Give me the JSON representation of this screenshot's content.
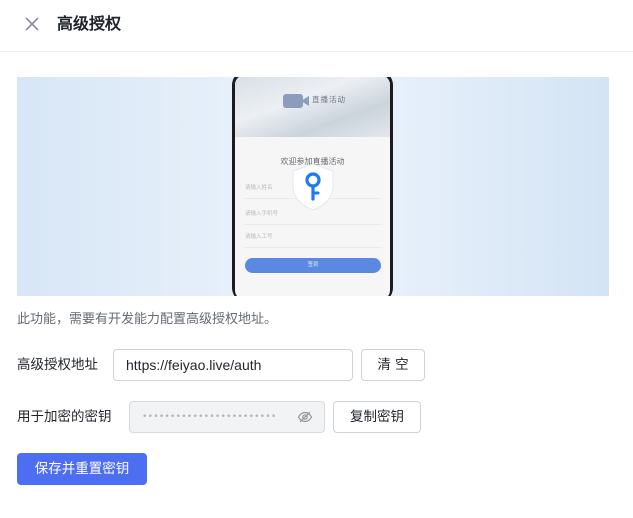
{
  "dialog": {
    "title": "高级授权"
  },
  "illustration": {
    "brand": "直播活动",
    "welcome": "欢迎参加直播活动",
    "fields": [
      "请输入姓名",
      "请输入手机号",
      "请输入工号"
    ],
    "submit_label": "签到"
  },
  "description": "此功能，需要有开发能力配置高级授权地址。",
  "auth_url": {
    "label": "高级授权地址",
    "value": "https://feiyao.live/auth",
    "clear_label": "清 空"
  },
  "secret_key": {
    "label": "用于加密的密钥",
    "masked_value": "••••••••••••••••••••••••",
    "copy_label": "复制密钥"
  },
  "save_button_label": "保存并重置密钥",
  "colors": {
    "primary": "#4e6ef2",
    "shield_key": "#1e7cf2",
    "phone_button": "#1c5ad6"
  },
  "icons": [
    "close-icon",
    "camera-icon",
    "shield-key-icon",
    "eye-off-icon"
  ]
}
